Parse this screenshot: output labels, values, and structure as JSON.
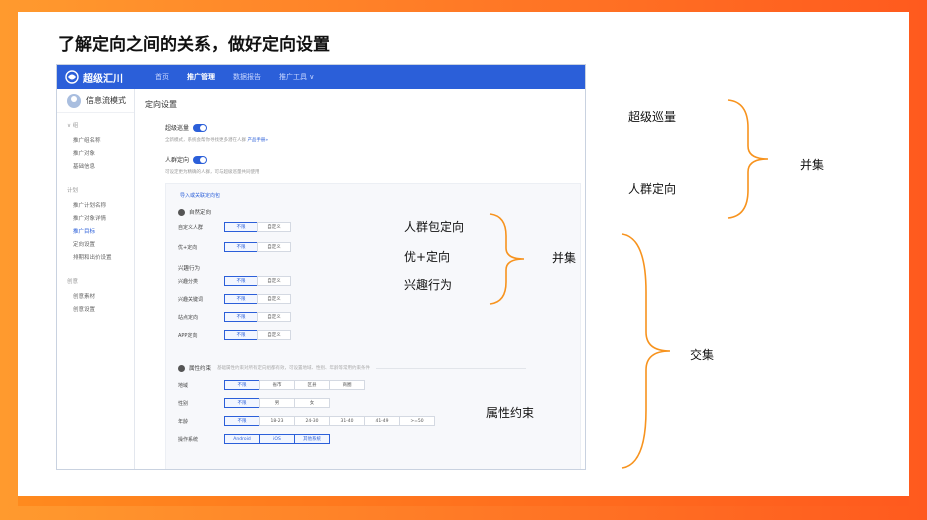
{
  "slide": {
    "title": "了解定向之间的关系，做好定向设置"
  },
  "app": {
    "logo": "超级汇川",
    "nav": [
      "首页",
      "推广管理",
      "数据报告",
      "推广工具 ∨"
    ],
    "mode_label": "信息流模式",
    "sidebar": [
      {
        "head": "∨ 组",
        "items": [
          "推广组名称",
          "推广对象",
          "基础信息"
        ]
      },
      {
        "head": "计划",
        "items": [
          "推广计划名称",
          "推广对象详情",
          "推广目标",
          "定向设置",
          "排期和出价设置"
        ]
      },
      {
        "head": "创意",
        "items": [
          "创意素材",
          "创意设置"
        ]
      }
    ],
    "section_title": "定向设置",
    "super_patrol": {
      "label": "超级巡量",
      "hint": "全新模式，系统会帮你寻找更多潜在人群",
      "hint_link": "产品手册»"
    },
    "crowd_targeting": {
      "label": "人群定向",
      "hint": "可设定更为精确的人群，可与超级巡量共同使用"
    },
    "panel_link": "导入或关联定向包",
    "crowd_section": {
      "head": "自然定向",
      "custom_label": "自定义人群",
      "youjia_label": "优+定向",
      "interest_head": "兴趣行为",
      "interest_rows": [
        "兴趣分类",
        "兴趣关键词",
        "站点定向",
        "APP定向"
      ],
      "opt_any": "不限",
      "opt_custom": "自定义"
    },
    "attr_section": {
      "head": "属性约束",
      "desc": "基础属性约束对所有定向组都有效，可设置地域、性别、年龄等常用约束条件",
      "region_label": "地域",
      "region_opts": [
        "不限",
        "省市",
        "区县",
        "商圈"
      ],
      "gender_label": "性别",
      "gender_opts": [
        "不限",
        "男",
        "女"
      ],
      "age_label": "年龄",
      "age_opts": [
        "不限",
        "18-23",
        "24-30",
        "31-40",
        "41-49",
        ">=50"
      ],
      "os_label": "操作系统",
      "os_opts": [
        "Android",
        "iOS",
        "其他系统"
      ]
    }
  },
  "annotations": {
    "super_patrol": "超级巡量",
    "crowd_targeting": "人群定向",
    "union_top": "并集",
    "crowd_pack": "人群包定向",
    "youjia": "优+定向",
    "interest": "兴趣行为",
    "union_mid": "并集",
    "intersection": "交集",
    "attr_constraint": "属性约束"
  },
  "colors": {
    "accent_orange": "#ff6a1e",
    "app_blue": "#2b5fd9",
    "brace_orange": "#f7931e"
  }
}
